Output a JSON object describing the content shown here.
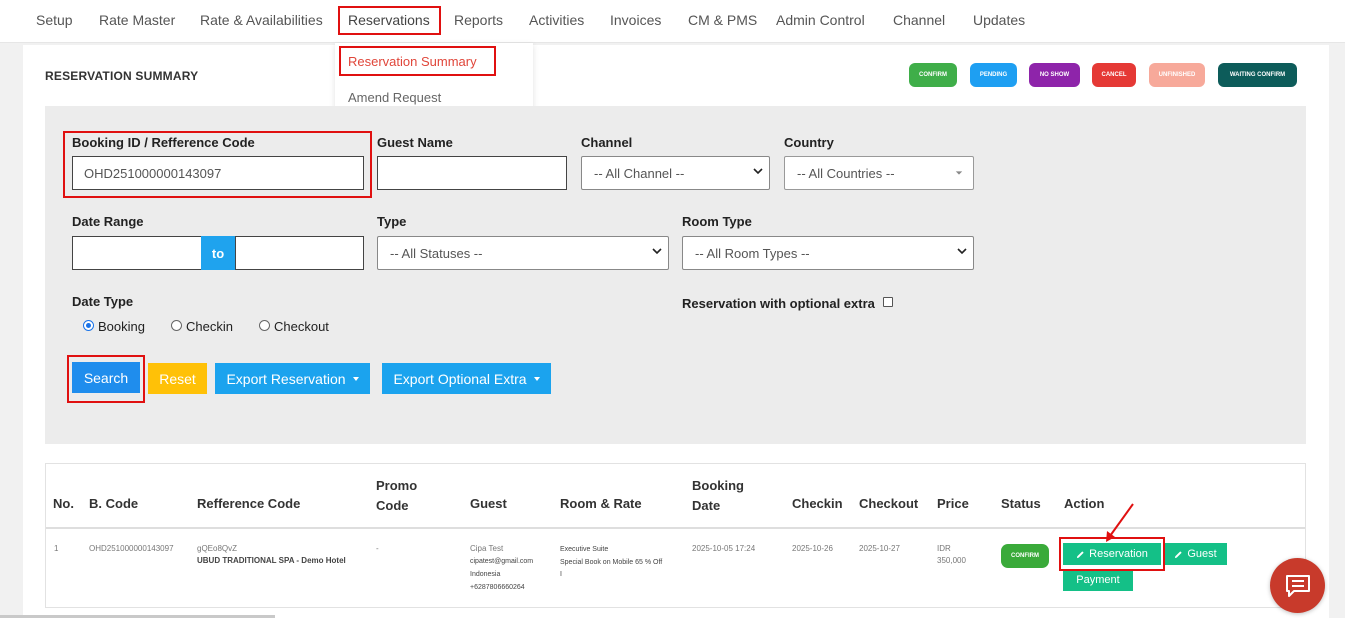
{
  "nav": {
    "items": [
      "Setup",
      "Rate Master",
      "Rate & Availabilities",
      "Reservations",
      "Reports",
      "Activities",
      "Invoices",
      "CM & PMS",
      "Admin Control",
      "Channel",
      "Updates"
    ],
    "dropdown": [
      "Reservation Summary",
      "Amend Request"
    ]
  },
  "page": {
    "title": "RESERVATION SUMMARY"
  },
  "legend": [
    {
      "label": "CONFIRM",
      "color": "#3fae49"
    },
    {
      "label": "PENDING",
      "color": "#1e9ff2"
    },
    {
      "label": "NO SHOW",
      "color": "#8e24aa"
    },
    {
      "label": "CANCEL",
      "color": "#e53935"
    },
    {
      "label": "UNFINISHED",
      "color": "#f7a99a"
    },
    {
      "label": "WAITING CONFIRM",
      "color": "#0d5c5a"
    }
  ],
  "filters": {
    "booking_id_label": "Booking ID / Refference Code",
    "booking_id_value": "OHD251000000143097",
    "guest_name_label": "Guest Name",
    "guest_name_value": "",
    "channel_label": "Channel",
    "channel_value": "-- All Channel --",
    "country_label": "Country",
    "country_value": "-- All Countries --",
    "date_range_label": "Date Range",
    "date_range_to": "to",
    "type_label": "Type",
    "type_value": "-- All Statuses --",
    "room_type_label": "Room Type",
    "room_type_value": "-- All Room Types --",
    "date_type_label": "Date Type",
    "date_type_options": [
      "Booking",
      "Checkin",
      "Checkout"
    ],
    "date_type_selected": "Booking",
    "optional_extra_label": "Reservation with optional extra"
  },
  "buttons": {
    "search": "Search",
    "reset": "Reset",
    "export_reservation": "Export Reservation",
    "export_optional_extra": "Export Optional Extra"
  },
  "table": {
    "headers": {
      "no": "No.",
      "bcode": "B. Code",
      "ref": "Refference Code",
      "promo": "Promo Code",
      "guest": "Guest",
      "room": "Room & Rate",
      "booking_date": "Booking Date",
      "checkin": "Checkin",
      "checkout": "Checkout",
      "price": "Price",
      "status": "Status",
      "action": "Action"
    },
    "rows": [
      {
        "no": "1",
        "bcode": "OHD251000000143097",
        "ref_code": "gQEo8QvZ",
        "ref_hotel": "UBUD TRADITIONAL SPA - Demo Hotel",
        "promo": "-",
        "guest_name": "Cipa Test",
        "guest_email": "cipatest@gmail.com",
        "guest_country": "Indonesia",
        "guest_phone": "+6287806660264",
        "room": "Executive Suite",
        "rate": "Special Book on Mobile 65 % Off",
        "rate_suffix": "I",
        "booking_date": "2025-10-05 17:24",
        "checkin": "2025-10-26",
        "checkout": "2025-10-27",
        "price_currency": "IDR",
        "price_amount": "350,000",
        "status": "CONFIRM",
        "actions": [
          "Reservation",
          "Guest",
          "Payment"
        ]
      }
    ]
  }
}
